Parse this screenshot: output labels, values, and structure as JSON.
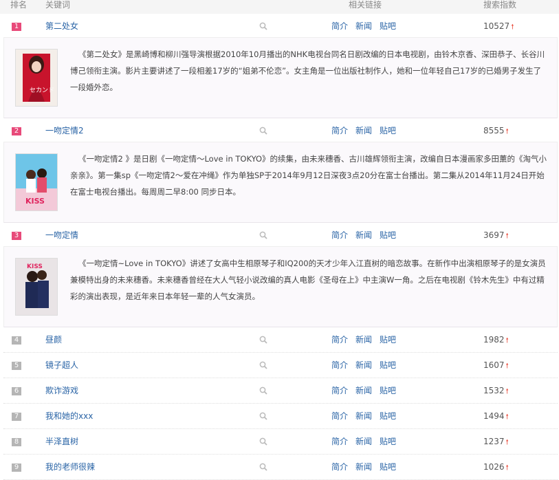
{
  "header": {
    "rank": "排名",
    "keyword": "关键词",
    "links": "相关链接",
    "index": "搜索指数"
  },
  "link_labels": {
    "intro": "简介",
    "news": "新闻",
    "tieba": "贴吧"
  },
  "items": [
    {
      "rank": "1",
      "keyword": "第二处女",
      "index": "10527",
      "desc": "《第二处女》是黑崎博和柳川强导演根据2010年10月播出的NHK电视台同名日剧改编的日本电视剧，由铃木京香、深田恭子、长谷川博己领衔主演。影片主要讲述了一段相差17岁的“姐弟不伦恋”。女主角是一位出版社制作人，她和一位年轻自己17岁的已婚男子发生了一段婚外恋。"
    },
    {
      "rank": "2",
      "keyword": "一吻定情2",
      "index": "8555",
      "desc": "《一吻定情2 》是日剧《一吻定情～Love in TOKYO》的续集，由未来穗香、古川雄辉领衔主演，改编自日本漫画家多田薰的《淘气小亲亲》。第一集sp《一吻定情2～爱在冲绳》作为单独SP于2014年9月12日深夜3点20分在富士台播出。第二集从2014年11月24日开始在富士电视台播出。每周周二早8:00 同步日本。"
    },
    {
      "rank": "3",
      "keyword": "一吻定情",
      "index": "3697",
      "desc": "《一吻定情~Love in TOKYO》讲述了女高中生相原琴子和IQ200的天才少年入江直树的暗恋故事。在新作中出演相原琴子的是女演员兼模特出身的未来穗香。未来穗香曾经在大人气轻小说改编的真人电影《圣母在上》中主演W一角。之后在电视剧《铃木先生》中有过精彩的演出表现，是近年来日本年轻一辈的人气女演员。"
    },
    {
      "rank": "4",
      "keyword": "昼颜",
      "index": "1982"
    },
    {
      "rank": "5",
      "keyword": "镜子超人",
      "index": "1607"
    },
    {
      "rank": "6",
      "keyword": "欺诈游戏",
      "index": "1532"
    },
    {
      "rank": "7",
      "keyword": "我和她的xxx",
      "index": "1494"
    },
    {
      "rank": "8",
      "keyword": "半泽直树",
      "index": "1237"
    },
    {
      "rank": "9",
      "keyword": "我的老师很辣",
      "index": "1026"
    }
  ]
}
